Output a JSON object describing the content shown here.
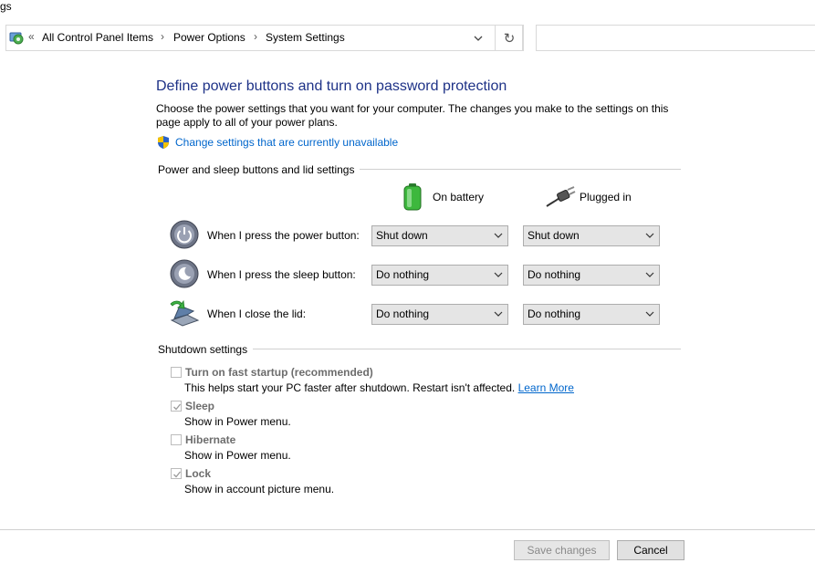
{
  "window": {
    "title_fragment": "gs"
  },
  "address_bar": {
    "overflow_chevron": "«",
    "breadcrumb": [
      "All Control Panel Items",
      "Power Options",
      "System Settings"
    ],
    "separator": "›",
    "dropdown_icon": "chevron-down-icon",
    "refresh_icon": "refresh-icon",
    "refresh_glyph": "↻",
    "search_value": ""
  },
  "page": {
    "title": "Define power buttons and turn on password protection",
    "description": "Choose the power settings that you want for your computer. The changes you make to the settings on this page apply to all of your power plans.",
    "change_settings_link": "Change settings that are currently unavailable"
  },
  "power_section": {
    "label": "Power and sleep buttons and lid settings",
    "columns": {
      "battery": "On battery",
      "plugged": "Plugged in"
    },
    "rows": [
      {
        "label": "When I press the power button:",
        "battery": "Shut down",
        "plugged": "Shut down",
        "icon": "power-button-icon"
      },
      {
        "label": "When I press the sleep button:",
        "battery": "Do nothing",
        "plugged": "Do nothing",
        "icon": "sleep-button-icon"
      },
      {
        "label": "When I close the lid:",
        "battery": "Do nothing",
        "plugged": "Do nothing",
        "icon": "laptop-lid-icon"
      }
    ]
  },
  "shutdown_section": {
    "label": "Shutdown settings",
    "items": [
      {
        "label": "Turn on fast startup (recommended)",
        "checked": false,
        "desc": "This helps start your PC faster after shutdown. Restart isn't affected. ",
        "link": "Learn More"
      },
      {
        "label": "Sleep",
        "checked": true,
        "desc": "Show in Power menu."
      },
      {
        "label": "Hibernate",
        "checked": false,
        "desc": "Show in Power menu."
      },
      {
        "label": "Lock",
        "checked": true,
        "desc": "Show in account picture menu."
      }
    ]
  },
  "buttons": {
    "save": "Save changes",
    "cancel": "Cancel"
  },
  "colors": {
    "heading": "#1e3287",
    "link": "#0066cc",
    "battery_green": "#3db83d"
  }
}
